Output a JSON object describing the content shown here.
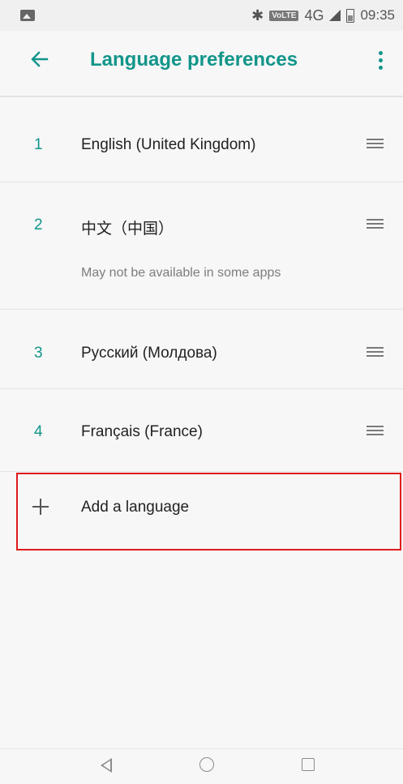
{
  "status_bar": {
    "network": "4G",
    "volte": "VoLTE",
    "time": "09:35"
  },
  "app_bar": {
    "title": "Language preferences"
  },
  "languages": [
    {
      "number": "1",
      "name": "English (United Kingdom)",
      "note": ""
    },
    {
      "number": "2",
      "name": "中文（中国）",
      "note": "May not be available in some apps"
    },
    {
      "number": "3",
      "name": "Русский (Молдова)",
      "note": ""
    },
    {
      "number": "4",
      "name": "Français (France)",
      "note": ""
    }
  ],
  "add_language": {
    "label": "Add a language"
  },
  "colors": {
    "accent": "#12958a",
    "highlight": "#e01b1b"
  }
}
